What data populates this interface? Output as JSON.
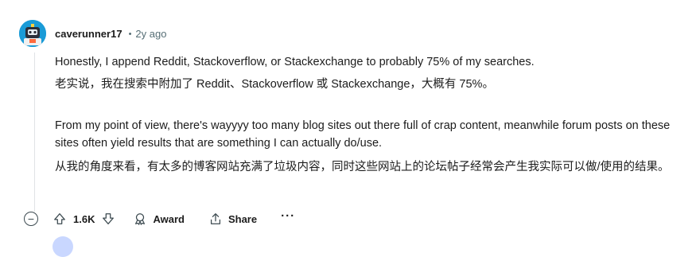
{
  "comment": {
    "username": "caverunner17",
    "separator": "•",
    "time": "2y ago",
    "paragraphs": {
      "en1": "Honestly, I append Reddit, Stackoverflow, or Stackexchange to probably 75% of my searches.",
      "zh1": "老实说，我在搜索中附加了 Reddit、Stackoverflow 或 Stackexchange，大概有 75%。",
      "en2": "From my point of view, there's wayyyy too many blog sites out there full of crap content, meanwhile forum posts on these sites often yield results that are something I can actually do/use.",
      "zh2": "从我的角度来看，有太多的博客网站充满了垃圾内容，同时这些网站上的论坛帖子经常会产生我实际可以做/使用的结果。"
    }
  },
  "actions": {
    "collapse_symbol": "−",
    "score": "1.6K",
    "award_label": "Award",
    "share_label": "Share",
    "more_label": "···"
  },
  "colors": {
    "meta": "#576f76",
    "text": "#1c1c1c",
    "avatar_bg": "#1a9bd7"
  },
  "icons": [
    "avatar",
    "upvote-icon",
    "downvote-icon",
    "award-icon",
    "share-icon",
    "more-icon",
    "collapse-icon"
  ]
}
